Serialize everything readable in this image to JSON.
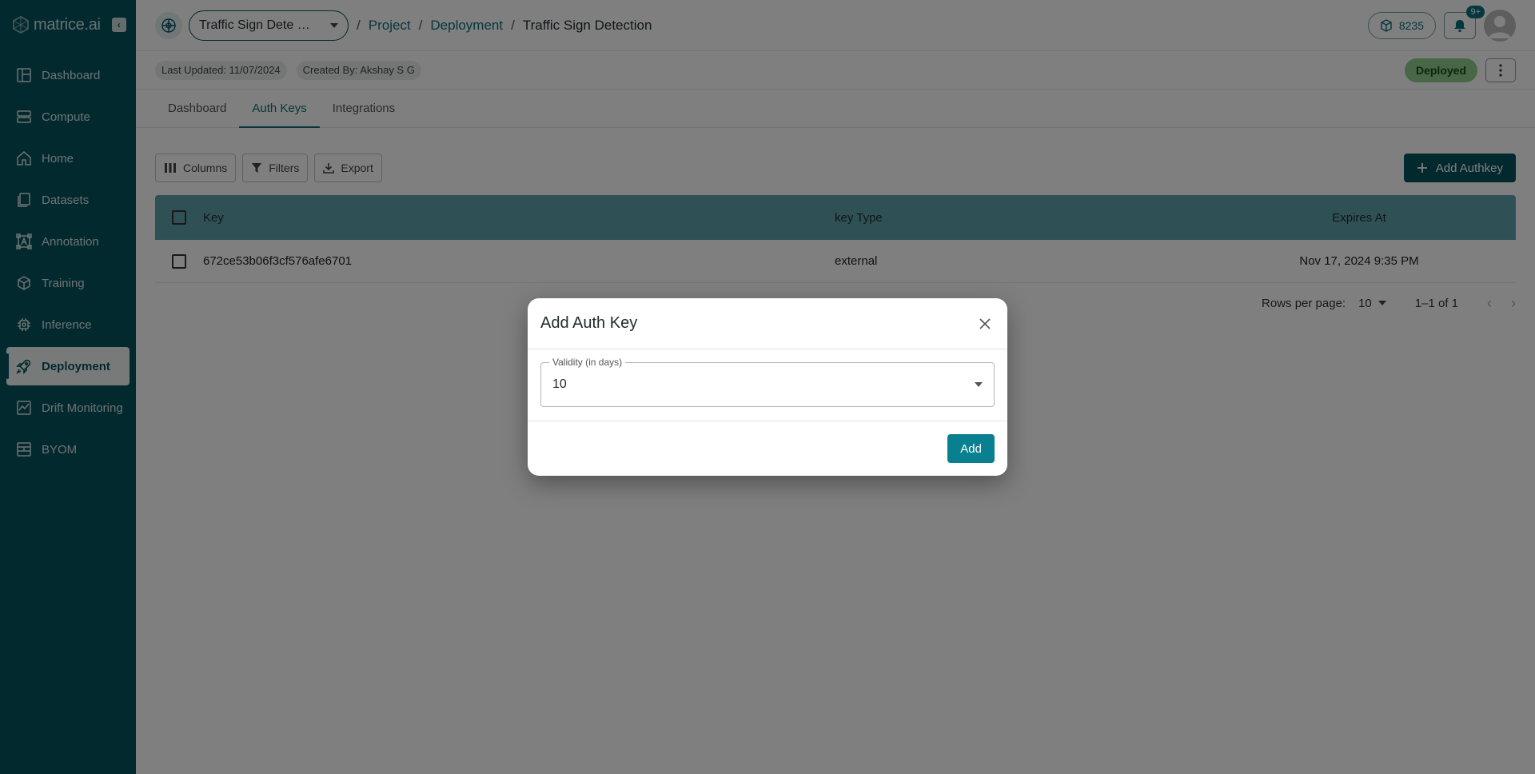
{
  "brand": {
    "logo_text": "matrice.ai"
  },
  "sidebar": {
    "items": [
      {
        "label": "Dashboard",
        "icon": "dashboard-icon"
      },
      {
        "label": "Compute",
        "icon": "server-icon"
      },
      {
        "label": "Home",
        "icon": "home-icon"
      },
      {
        "label": "Datasets",
        "icon": "files-icon"
      },
      {
        "label": "Annotation",
        "icon": "annotation-icon"
      },
      {
        "label": "Training",
        "icon": "training-icon"
      },
      {
        "label": "Inference",
        "icon": "chip-icon"
      },
      {
        "label": "Deployment",
        "icon": "rocket-icon",
        "active": true
      },
      {
        "label": "Drift Monitoring",
        "icon": "chart-icon"
      },
      {
        "label": "BYOM",
        "icon": "model-icon"
      }
    ]
  },
  "topbar": {
    "project_select": "Traffic Sign Dete …",
    "breadcrumb": {
      "project": "Project",
      "deployment": "Deployment",
      "current": "Traffic Sign Detection",
      "sep": "/"
    },
    "credits": "8235",
    "notifications_badge": "9+"
  },
  "infobar": {
    "last_updated": "Last Updated: 11/07/2024",
    "created_by": "Created By: Akshay S G",
    "status": "Deployed"
  },
  "tabs": [
    {
      "label": "Dashboard"
    },
    {
      "label": "Auth Keys",
      "active": true
    },
    {
      "label": "Integrations"
    }
  ],
  "toolbar": {
    "columns": "Columns",
    "filters": "Filters",
    "export": "Export",
    "add_authkey": "Add Authkey"
  },
  "table": {
    "headers": {
      "key": "Key",
      "type": "key Type",
      "expires": "Expires At"
    },
    "rows": [
      {
        "key": "672ce53b06f3cf576afe6701",
        "type": "external",
        "expires": "Nov 17, 2024 9:35 PM"
      }
    ],
    "pagination": {
      "rows_per_page_label": "Rows per page:",
      "rows_per_page": "10",
      "range": "1–1 of 1"
    }
  },
  "modal": {
    "title": "Add Auth Key",
    "validity_label": "Validity (in days)",
    "validity_value": "10",
    "add_label": "Add"
  },
  "colors": {
    "sidebar": "#05535c",
    "accent": "#0a6f7d",
    "header_row": "#5fa2ab",
    "deployed": "#8fce8c"
  }
}
